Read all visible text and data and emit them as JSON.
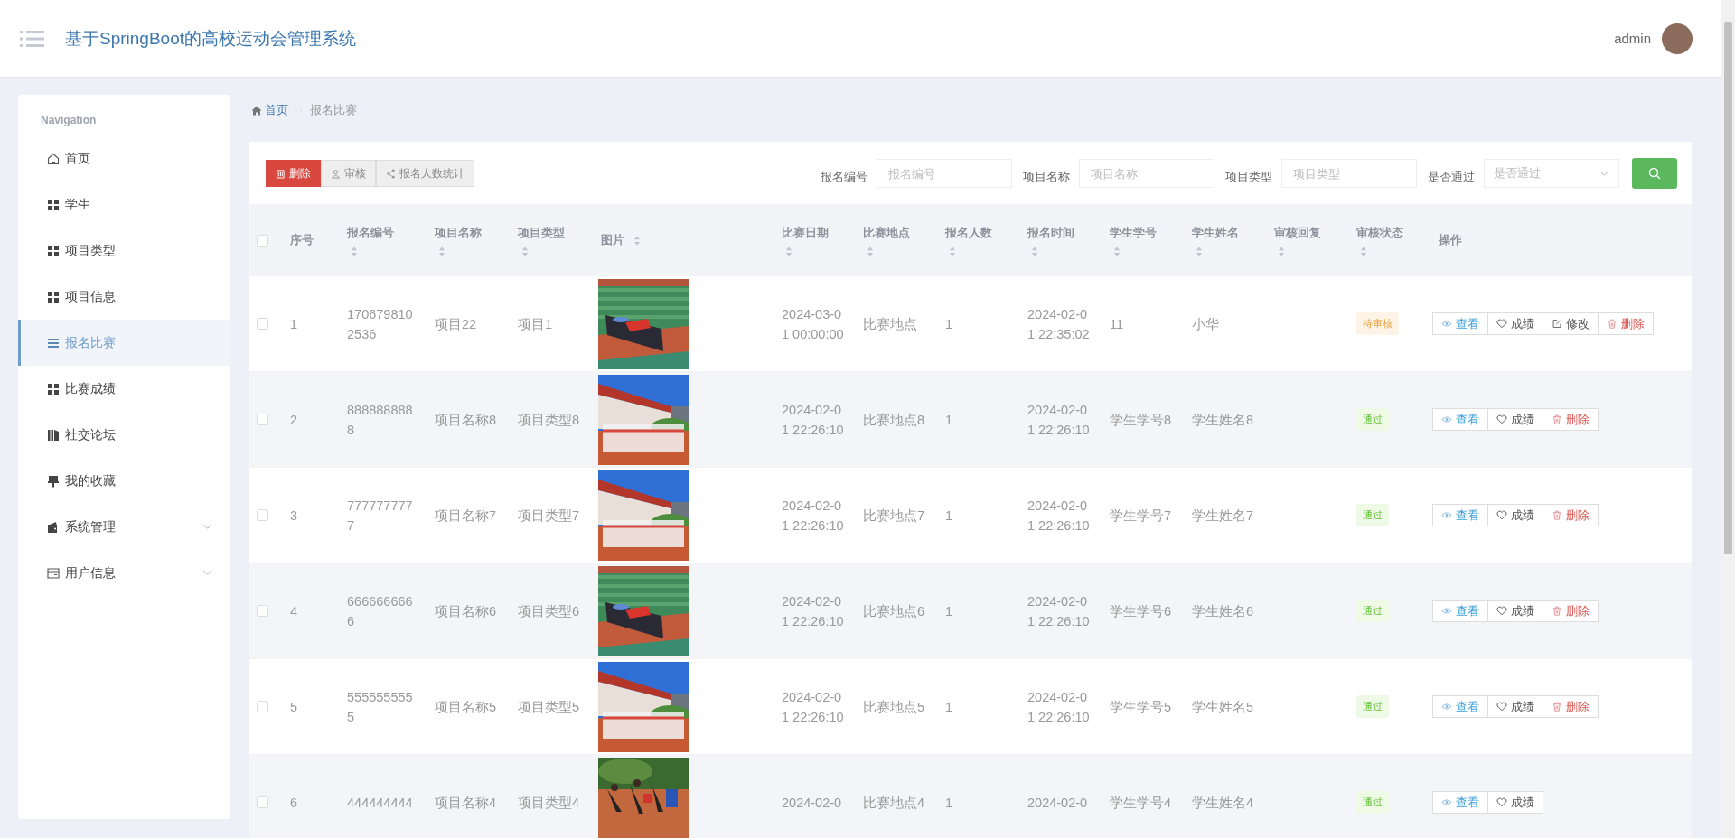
{
  "header": {
    "title": "基于SpringBoot的高校运动会管理系统",
    "user": "admin"
  },
  "sidebar": {
    "heading": "Navigation",
    "items": [
      {
        "label": "首页",
        "kind": "home",
        "selected": false
      },
      {
        "label": "学生",
        "kind": "grid",
        "selected": false
      },
      {
        "label": "项目类型",
        "kind": "grid",
        "selected": false
      },
      {
        "label": "项目信息",
        "kind": "grid",
        "selected": false
      },
      {
        "label": "报名比赛",
        "kind": "list",
        "selected": true
      },
      {
        "label": "比赛成绩",
        "kind": "grid",
        "selected": false
      },
      {
        "label": "社交论坛",
        "kind": "books",
        "selected": false
      },
      {
        "label": "我的收藏",
        "kind": "pin",
        "selected": false
      },
      {
        "label": "系统管理",
        "kind": "wallet",
        "selected": false,
        "expanded": false
      },
      {
        "label": "用户信息",
        "kind": "card",
        "selected": false,
        "expanded": false
      }
    ]
  },
  "breadcrumb": [
    {
      "label": "首页",
      "kind": "home"
    },
    {
      "label": "报名比赛",
      "kind": "current"
    }
  ],
  "toolbar": [
    {
      "label": "删除",
      "kind": "danger"
    },
    {
      "label": "审核",
      "kind": "audit"
    },
    {
      "label": "报名人数统计",
      "kind": "stats"
    }
  ],
  "search": [
    {
      "label": "报名编号",
      "placeholder": "报名编号",
      "kind": "input"
    },
    {
      "label": "项目名称",
      "placeholder": "项目名称",
      "kind": "input"
    },
    {
      "label": "项目类型",
      "placeholder": "项目类型",
      "kind": "input"
    },
    {
      "label": "是否通过",
      "placeholder": "是否通过",
      "kind": "select"
    }
  ],
  "table": {
    "all_checked": false,
    "columns": [
      {
        "label": "序号",
        "sortable": false
      },
      {
        "label": "报名编号",
        "sortable": true
      },
      {
        "label": "项目名称",
        "sortable": true
      },
      {
        "label": "项目类型",
        "sortable": true
      },
      {
        "label": "图片",
        "sortable": true
      },
      {
        "label": "比赛日期",
        "sortable": true
      },
      {
        "label": "比赛地点",
        "sortable": true
      },
      {
        "label": "报名人数",
        "sortable": true
      },
      {
        "label": "报名时间",
        "sortable": true
      },
      {
        "label": "学生学号",
        "sortable": true
      },
      {
        "label": "学生姓名",
        "sortable": true
      },
      {
        "label": "审核回复",
        "sortable": true
      },
      {
        "label": "审核状态",
        "sortable": true
      },
      {
        "label": "操作",
        "sortable": false
      }
    ],
    "rows": [
      {
        "checked": false,
        "cells": [
          "1",
          "1706798102536",
          "项目22",
          "项目1",
          null,
          "2024-03-01 00:00:00",
          "比赛地点",
          "1",
          "2024-02-01 22:35:02",
          "11",
          "小华",
          ""
        ],
        "status": {
          "text": "待审核",
          "kind": "pending"
        },
        "actions": [
          {
            "label": "查看",
            "kind": "view"
          },
          {
            "label": "成绩",
            "kind": "score"
          },
          {
            "label": "修改",
            "kind": "edit"
          },
          {
            "label": "删除",
            "kind": "delete"
          }
        ]
      },
      {
        "checked": false,
        "cells": [
          "2",
          "8888888888",
          "项目名称8",
          "项目类型8",
          null,
          "2024-02-01 22:26:10",
          "比赛地点8",
          "1",
          "2024-02-01 22:26:10",
          "学生学号8",
          "学生姓名8",
          ""
        ],
        "status": {
          "text": "通过",
          "kind": "passed"
        },
        "actions": [
          {
            "label": "查看",
            "kind": "view"
          },
          {
            "label": "成绩",
            "kind": "score"
          },
          {
            "label": "删除",
            "kind": "delete"
          }
        ]
      },
      {
        "checked": false,
        "cells": [
          "3",
          "7777777777",
          "项目名称7",
          "项目类型7",
          null,
          "2024-02-01 22:26:10",
          "比赛地点7",
          "1",
          "2024-02-01 22:26:10",
          "学生学号7",
          "学生姓名7",
          ""
        ],
        "status": {
          "text": "通过",
          "kind": "passed"
        },
        "actions": [
          {
            "label": "查看",
            "kind": "view"
          },
          {
            "label": "成绩",
            "kind": "score"
          },
          {
            "label": "删除",
            "kind": "delete"
          }
        ]
      },
      {
        "checked": false,
        "cells": [
          "4",
          "6666666666",
          "项目名称6",
          "项目类型6",
          null,
          "2024-02-01 22:26:10",
          "比赛地点6",
          "1",
          "2024-02-01 22:26:10",
          "学生学号6",
          "学生姓名6",
          ""
        ],
        "status": {
          "text": "通过",
          "kind": "passed"
        },
        "actions": [
          {
            "label": "查看",
            "kind": "view"
          },
          {
            "label": "成绩",
            "kind": "score"
          },
          {
            "label": "删除",
            "kind": "delete"
          }
        ]
      },
      {
        "checked": false,
        "cells": [
          "5",
          "5555555555",
          "项目名称5",
          "项目类型5",
          null,
          "2024-02-01 22:26:10",
          "比赛地点5",
          "1",
          "2024-02-01 22:26:10",
          "学生学号5",
          "学生姓名5",
          ""
        ],
        "status": {
          "text": "通过",
          "kind": "passed"
        },
        "actions": [
          {
            "label": "查看",
            "kind": "view"
          },
          {
            "label": "成绩",
            "kind": "score"
          },
          {
            "label": "删除",
            "kind": "delete"
          }
        ]
      },
      {
        "checked": false,
        "cells": [
          "6",
          "444444444",
          "项目名称4",
          "项目类型4",
          null,
          "2024-02-0",
          "比赛地点4",
          "1",
          "2024-02-0",
          "学生学号4",
          "学生姓名4",
          ""
        ],
        "status": {
          "text": "通过",
          "kind": "passed"
        },
        "actions": [
          {
            "label": "查看",
            "kind": "view"
          },
          {
            "label": "成绩",
            "kind": "score"
          }
        ]
      }
    ]
  }
}
